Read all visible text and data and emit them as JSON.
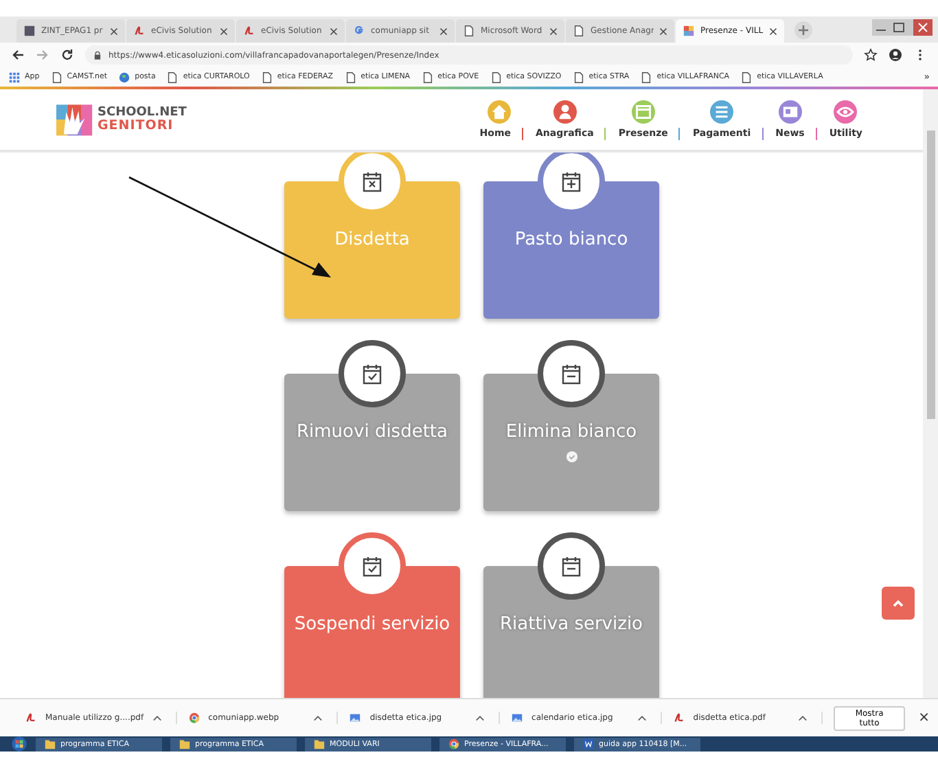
{
  "browser": {
    "tabs": [
      {
        "title": "ZINT_EPAG1 pr",
        "kind": "doc",
        "selected": false
      },
      {
        "title": "eCivis Solution",
        "kind": "pdf",
        "selected": false
      },
      {
        "title": "eCivis Solution",
        "kind": "pdf",
        "selected": false
      },
      {
        "title": "comuniapp sit",
        "kind": "g",
        "selected": false
      },
      {
        "title": "Microsoft Word",
        "kind": "page",
        "selected": false
      },
      {
        "title": "Gestione Anagr",
        "kind": "page",
        "selected": false
      },
      {
        "title": "Presenze - VILL",
        "kind": "app",
        "selected": true
      }
    ],
    "address": "https://www4.eticasoluzioni.com/villafrancapadovanaportalegen/Presenze/Index",
    "bookmarks": [
      {
        "label": "App",
        "kind": "apps"
      },
      {
        "label": "CAMST.net",
        "kind": "page"
      },
      {
        "label": "posta",
        "kind": "globe"
      },
      {
        "label": "etica CURTAROLO",
        "kind": "page"
      },
      {
        "label": "etica FEDERAZ",
        "kind": "page"
      },
      {
        "label": "etica LIMENA",
        "kind": "page"
      },
      {
        "label": "etica POVE",
        "kind": "page"
      },
      {
        "label": "etica SOVIZZO",
        "kind": "page"
      },
      {
        "label": "etica STRA",
        "kind": "page"
      },
      {
        "label": "etica VILLAFRANCA",
        "kind": "page"
      },
      {
        "label": "etica VILLAVERLA",
        "kind": "page"
      }
    ],
    "bookmarks_more": "»"
  },
  "header": {
    "logo_top": "SCHOOL.NET",
    "logo_bottom": "GENITORI",
    "nav": [
      {
        "label": "Home",
        "color": "#e8b83a",
        "kind": "home"
      },
      {
        "label": "Anagrafica",
        "color": "#e0584a",
        "kind": "person"
      },
      {
        "label": "Presenze",
        "color": "#9ccc5a",
        "kind": "calendar"
      },
      {
        "label": "Pagamenti",
        "color": "#5aa9d6",
        "kind": "list"
      },
      {
        "label": "News",
        "color": "#9a86d8",
        "kind": "card"
      },
      {
        "label": "Utility",
        "color": "#e86aa8",
        "kind": "eye"
      }
    ]
  },
  "cards": [
    {
      "label": "Disdetta",
      "color": "#f0c04a",
      "disabled": false,
      "kind": "x"
    },
    {
      "label": "Pasto bianco",
      "color": "#7d86c8",
      "disabled": false,
      "kind": "plus"
    },
    {
      "label": "Rimuovi disdetta",
      "color": "#a4a4a4",
      "disabled": true,
      "kind": "check"
    },
    {
      "label": "Elimina bianco",
      "color": "#a4a4a4",
      "disabled": true,
      "kind": "minus",
      "badge": true
    },
    {
      "label": "Sospendi servizio",
      "color": "#e8675a",
      "disabled": false,
      "kind": "check"
    },
    {
      "label": "Riattiva servizio",
      "color": "#a4a4a4",
      "disabled": true,
      "kind": "minus"
    }
  ],
  "downloads": [
    {
      "name": "Manuale utilizzo g....pdf",
      "kind": "pdf"
    },
    {
      "name": "comuniapp.webp",
      "kind": "chrome"
    },
    {
      "name": "disdetta etica.jpg",
      "kind": "image"
    },
    {
      "name": "calendario etica.jpg",
      "kind": "image"
    },
    {
      "name": "disdetta etica.pdf",
      "kind": "pdf"
    }
  ],
  "show_all": "Mostra tutto",
  "close": "×",
  "taskbar": [
    {
      "label": "programma ETICA",
      "kind": "folder"
    },
    {
      "label": "programma ETICA",
      "kind": "folder"
    },
    {
      "label": "MODULI VARI",
      "kind": "folder"
    },
    {
      "label": "Presenze - VILLAFRA...",
      "kind": "chrome"
    },
    {
      "label": "guida app 110418 [M...",
      "kind": "word"
    }
  ]
}
